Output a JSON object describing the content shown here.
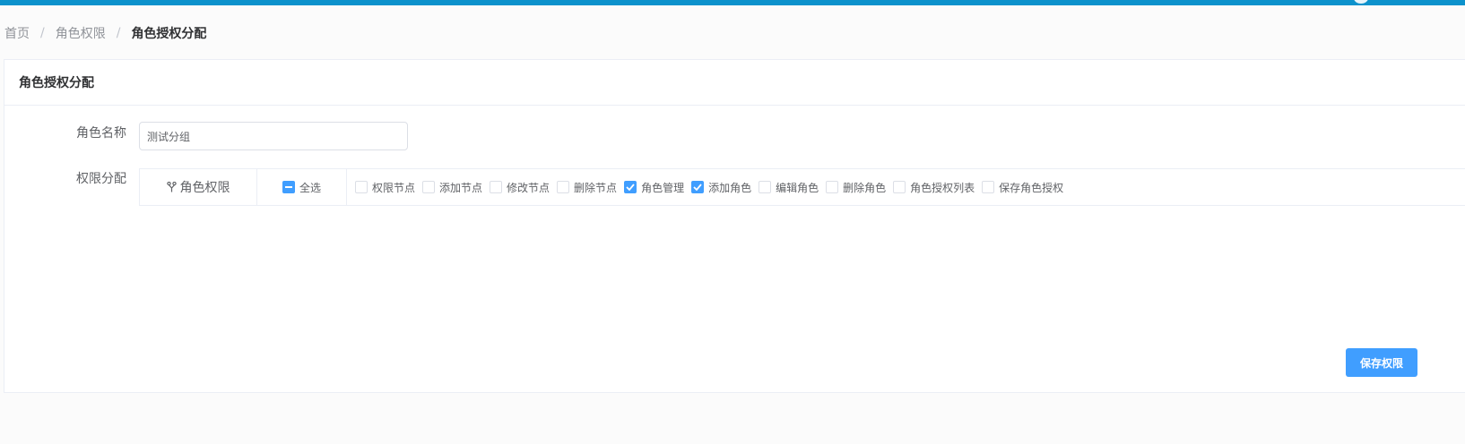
{
  "breadcrumb": {
    "items": [
      "首页",
      "角色权限",
      "角色授权分配"
    ],
    "separator": "/"
  },
  "card": {
    "title": "角色授权分配"
  },
  "form": {
    "role_name_label": "角色名称",
    "role_name_value": "测试分组",
    "permission_label": "权限分配"
  },
  "permissions": {
    "group_label": "角色权限",
    "group_icon": "branch-icon",
    "select_all_label": "全选",
    "select_all_state": "indeterminate",
    "items": [
      {
        "label": "权限节点",
        "checked": false
      },
      {
        "label": "添加节点",
        "checked": false
      },
      {
        "label": "修改节点",
        "checked": false
      },
      {
        "label": "删除节点",
        "checked": false
      },
      {
        "label": "角色管理",
        "checked": true
      },
      {
        "label": "添加角色",
        "checked": true
      },
      {
        "label": "编辑角色",
        "checked": false
      },
      {
        "label": "删除角色",
        "checked": false
      },
      {
        "label": "角色授权列表",
        "checked": false
      },
      {
        "label": "保存角色授权",
        "checked": false
      }
    ]
  },
  "actions": {
    "save_label": "保存权限"
  },
  "colors": {
    "topbar": "#0c92cc",
    "primary": "#409eff"
  }
}
